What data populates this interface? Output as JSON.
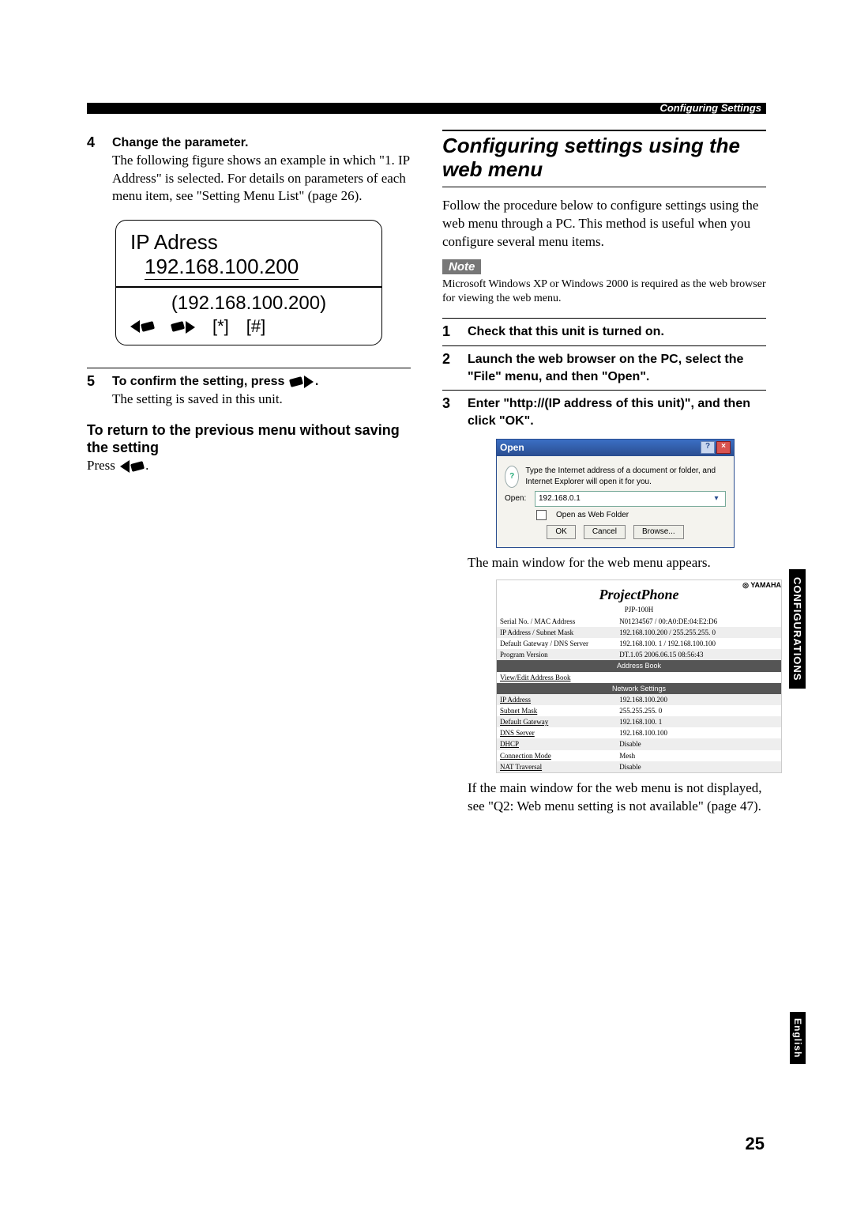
{
  "header": {
    "section": "Configuring Settings"
  },
  "left": {
    "step4": {
      "num": "4",
      "title": "Change the parameter.",
      "body": "The following figure shows an example in which \"1. IP Address\" is selected. For details on parameters of each menu item, see \"Setting Menu List\" (page 26)."
    },
    "lcd": {
      "line1": "IP Adress",
      "line2": "192.168.100.200",
      "line3": "(192.168.100.200)",
      "sym_ast": "[*]",
      "sym_hash": "[#]"
    },
    "step5": {
      "num": "5",
      "title_pre": "To confirm the setting, press ",
      "title_post": ".",
      "body": "The setting is saved in this unit."
    },
    "subhead": "To return to the previous menu without saving the setting",
    "sub_body_pre": "Press ",
    "sub_body_post": "."
  },
  "right": {
    "title": "Configuring settings using the web menu",
    "intro": "Follow the procedure below to configure settings using the web menu through a PC. This method is useful when you configure several menu items.",
    "note_label": "Note",
    "note_body": "Microsoft Windows XP or Windows 2000 is required as the web browser for viewing the web menu.",
    "step1": {
      "num": "1",
      "title": "Check that this unit is turned on."
    },
    "step2": {
      "num": "2",
      "title": "Launch the web browser on the PC, select the \"File\" menu, and then \"Open\"."
    },
    "step3": {
      "num": "3",
      "title": "Enter \"http://(IP address of this unit)\", and then click \"OK\"."
    },
    "dialog": {
      "title": "Open",
      "desc": "Type the Internet address of a document or folder, and Internet Explorer will open it for you.",
      "open_label": "Open:",
      "value": "192.168.0.1",
      "checkbox": "Open as Web Folder",
      "ok": "OK",
      "cancel": "Cancel",
      "browse": "Browse..."
    },
    "after_dialog": "The main window for the web menu appears.",
    "webmenu": {
      "brand": "YAMAHA",
      "logo": "ProjectPhone",
      "model": "PJP-100H",
      "rows_top": [
        {
          "k": "Serial No. / MAC Address",
          "v": "N01234567 / 00:A0:DE:04:E2:D6"
        },
        {
          "k": "IP Address / Subnet Mask",
          "v": "192.168.100.200 / 255.255.255. 0"
        },
        {
          "k": "Default Gateway / DNS Server",
          "v": "192.168.100. 1 / 192.168.100.100"
        },
        {
          "k": "Program Version",
          "v": "DT.1.05 2006.06.15 08:56:43"
        }
      ],
      "bar1": "Address Book",
      "row_ab": "View/Edit Address Book",
      "bar2": "Network Settings",
      "rows_net": [
        {
          "k": "IP Address",
          "v": "192.168.100.200"
        },
        {
          "k": "Subnet Mask",
          "v": "255.255.255. 0"
        },
        {
          "k": "Default Gateway",
          "v": "192.168.100. 1"
        },
        {
          "k": "DNS Server",
          "v": "192.168.100.100"
        },
        {
          "k": "DHCP",
          "v": "Disable"
        },
        {
          "k": "Connection Mode",
          "v": "Mesh"
        },
        {
          "k": "NAT Traversal",
          "v": "Disable"
        }
      ]
    },
    "after_webmenu": "If the main window for the web menu is not displayed, see \"Q2: Web menu setting is not available\" (page 47)."
  },
  "side": {
    "configs": "CONFIGURATIONS",
    "english": "English"
  },
  "page_number": "25"
}
